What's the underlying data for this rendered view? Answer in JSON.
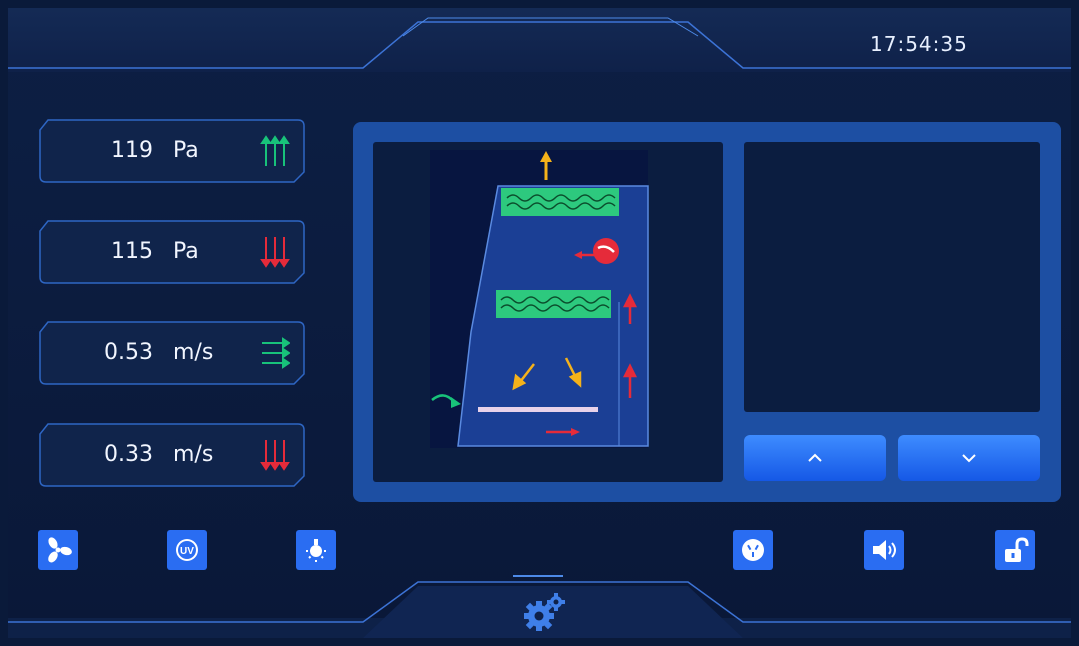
{
  "header": {
    "time": "17:54:35"
  },
  "sensors": [
    {
      "value": "119",
      "unit": "Pa",
      "indicator": "arrows-up",
      "indicator_color": "#18c27a"
    },
    {
      "value": "115",
      "unit": "Pa",
      "indicator": "arrows-down",
      "indicator_color": "#e52b3a"
    },
    {
      "value": "0.53",
      "unit": "m/s",
      "indicator": "arrows-right",
      "indicator_color": "#18c27a"
    },
    {
      "value": "0.33",
      "unit": "m/s",
      "indicator": "arrows-down",
      "indicator_color": "#e52b3a"
    }
  ],
  "airflow_diagram": {
    "elements": [
      "exhaust-arrow",
      "upper-filter",
      "fan",
      "lower-filter",
      "inflow-arrows",
      "work-surface",
      "side-arrows",
      "front-intake-arrow",
      "bottom-arrow"
    ]
  },
  "display": {
    "up_icon": "chevron-up-icon",
    "down_icon": "chevron-down-icon"
  },
  "toolbar": {
    "left": [
      "fan-icon",
      "uv-icon",
      "light-icon"
    ],
    "right": [
      "socket-icon",
      "speaker-icon",
      "unlock-icon"
    ],
    "center": "settings-gear-icon"
  },
  "colors": {
    "accent": "#2a6df2",
    "panel": "#1d4fa3",
    "background": "#0a1a3a",
    "green": "#18c27a",
    "red": "#e52b3a",
    "yellow": "#f5b21a"
  }
}
